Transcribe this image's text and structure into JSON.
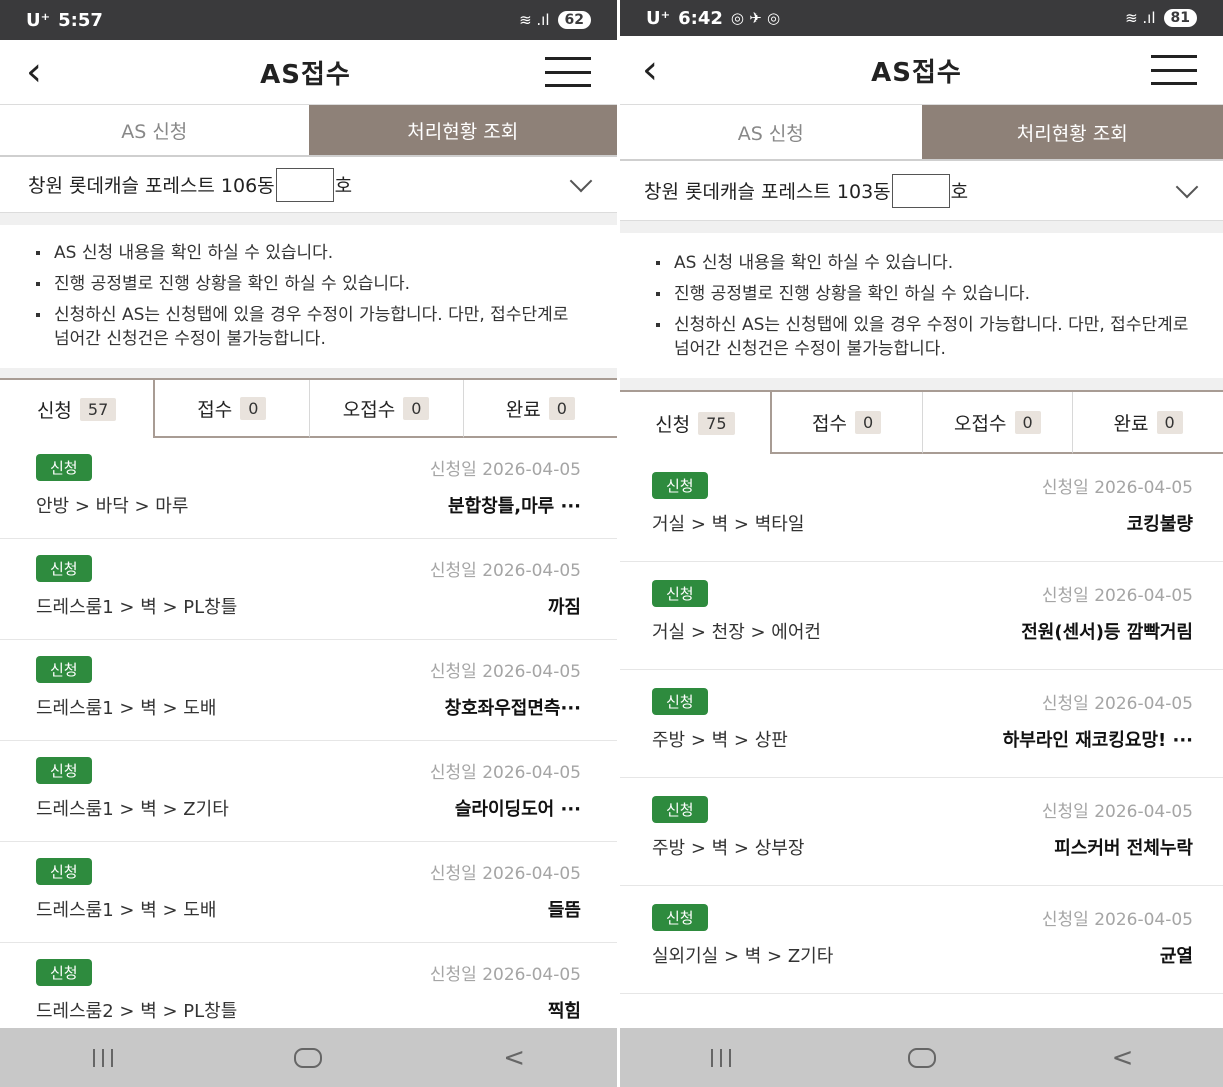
{
  "screens": [
    {
      "status": {
        "carrier": "U⁺",
        "time": "5:57",
        "extra_icons": "",
        "signal": "≋ .ıl",
        "battery": "62"
      },
      "header": {
        "back_icon": "‹",
        "title": "AS접수"
      },
      "main_tabs": [
        {
          "label": "AS 신청",
          "active": false
        },
        {
          "label": "처리현황 조회",
          "active": true
        }
      ],
      "complex": {
        "prefix": "창원 롯데캐슬 포레스트 106동",
        "suffix": "호"
      },
      "notices": [
        "AS 신청 내용을 확인 하실 수 있습니다.",
        "진행 공정별로 진행 상황을 확인 하실 수 있습니다.",
        "신청하신 AS는 신청탭에 있을 경우 수정이 가능합니다. 다만, 접수단계로 넘어간 신청건은 수정이 불가능합니다."
      ],
      "status_tabs": [
        {
          "label": "신청",
          "count": "57",
          "active": true
        },
        {
          "label": "접수",
          "count": "0",
          "active": false
        },
        {
          "label": "오접수",
          "count": "0",
          "active": false
        },
        {
          "label": "완료",
          "count": "0",
          "active": false
        }
      ],
      "requests": [
        {
          "badge": "신청",
          "date": "신청일 2026-04-05",
          "path": "안방 > 바닥 > 마루",
          "desc": "분합창틀,마루 ···"
        },
        {
          "badge": "신청",
          "date": "신청일 2026-04-05",
          "path": "드레스룸1 > 벽 > PL창틀",
          "desc": "까짐"
        },
        {
          "badge": "신청",
          "date": "신청일 2026-04-05",
          "path": "드레스룸1 > 벽 > 도배",
          "desc": "창호좌우접면측···"
        },
        {
          "badge": "신청",
          "date": "신청일 2026-04-05",
          "path": "드레스룸1 > 벽 > Z기타",
          "desc": "슬라이딩도어 ···"
        },
        {
          "badge": "신청",
          "date": "신청일 2026-04-05",
          "path": "드레스룸1 > 벽 > 도배",
          "desc": "들뜸"
        },
        {
          "badge": "신청",
          "date": "신청일 2026-04-05",
          "path": "드레스룸2 > 벽 > PL창틀",
          "desc": "찍힘"
        }
      ],
      "nav": {
        "back_icon": "<"
      }
    },
    {
      "status": {
        "carrier": "U⁺",
        "time": "6:42",
        "extra_icons": "◎ ✈ ◎",
        "signal": "≋ .ıl",
        "battery": "81"
      },
      "header": {
        "back_icon": "‹",
        "title": "AS접수"
      },
      "main_tabs": [
        {
          "label": "AS 신청",
          "active": false
        },
        {
          "label": "처리현황 조회",
          "active": true
        }
      ],
      "complex": {
        "prefix": "창원 롯데캐슬 포레스트 103동",
        "suffix": "호"
      },
      "notices": [
        "AS 신청 내용을 확인 하실 수 있습니다.",
        "진행 공정별로 진행 상황을 확인 하실 수 있습니다.",
        "신청하신 AS는 신청탭에 있을 경우 수정이 가능합니다. 다만, 접수단계로 넘어간 신청건은 수정이 불가능합니다."
      ],
      "status_tabs": [
        {
          "label": "신청",
          "count": "75",
          "active": true
        },
        {
          "label": "접수",
          "count": "0",
          "active": false
        },
        {
          "label": "오접수",
          "count": "0",
          "active": false
        },
        {
          "label": "완료",
          "count": "0",
          "active": false
        }
      ],
      "requests": [
        {
          "badge": "신청",
          "date": "신청일 2026-04-05",
          "path": "거실 > 벽 > 벽타일",
          "desc": "코킹불량"
        },
        {
          "badge": "신청",
          "date": "신청일 2026-04-05",
          "path": "거실 > 천장 > 에어컨",
          "desc": "전원(센서)등 깜빡거림"
        },
        {
          "badge": "신청",
          "date": "신청일 2026-04-05",
          "path": "주방 > 벽 > 상판",
          "desc": "하부라인 재코킹요망! ···"
        },
        {
          "badge": "신청",
          "date": "신청일 2026-04-05",
          "path": "주방 > 벽 > 상부장",
          "desc": "피스커버 전체누락"
        },
        {
          "badge": "신청",
          "date": "신청일 2026-04-05",
          "path": "실외기실 > 벽 > Z기타",
          "desc": "균열"
        }
      ],
      "nav": {
        "back_icon": "<"
      }
    }
  ]
}
